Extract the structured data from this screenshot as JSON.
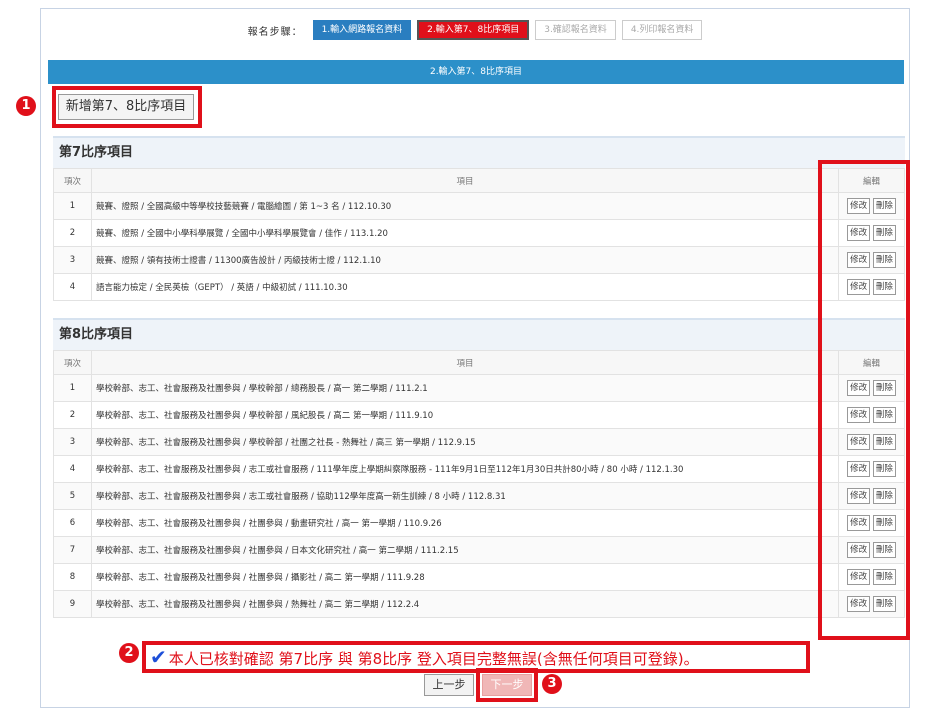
{
  "steps": {
    "label": "報名步驟：",
    "items": [
      {
        "label": "1.輸入網路報名資料",
        "state": "done"
      },
      {
        "label": "2.輸入第7、8比序項目",
        "state": "active"
      },
      {
        "label": "3.確認報名資料",
        "state": "pending"
      },
      {
        "label": "4.列印報名資料",
        "state": "pending"
      }
    ]
  },
  "banner": "2.輸入第7、8比序項目",
  "add_button": "新增第7、8比序項目",
  "badges": [
    "1",
    "2",
    "3"
  ],
  "section7": {
    "title": "第7比序項目",
    "headers": {
      "num": "項次",
      "item": "項目",
      "edit": "編輯"
    },
    "rows": [
      {
        "num": "1",
        "item": "競賽、證照 / 全國高級中等學校技藝競賽 / 電腦繪圖 / 第 1~3 名 / 112.10.30"
      },
      {
        "num": "2",
        "item": "競賽、證照 / 全國中小學科學展覽 / 全國中小學科學展覽會 / 佳作 / 113.1.20"
      },
      {
        "num": "3",
        "item": "競賽、證照 / 領有技術士證書 / 11300廣告設計 / 丙級技術士證 / 112.1.10"
      },
      {
        "num": "4",
        "item": "語言能力檢定 / 全民英檢（GEPT） / 英語 / 中級初試 / 111.10.30"
      }
    ]
  },
  "section8": {
    "title": "第8比序項目",
    "headers": {
      "num": "項次",
      "item": "項目",
      "edit": "編輯"
    },
    "rows": [
      {
        "num": "1",
        "item": "學校幹部、志工、社會服務及社團參與 / 學校幹部 / 總務股長 / 高一 第二學期 / 111.2.1"
      },
      {
        "num": "2",
        "item": "學校幹部、志工、社會服務及社團參與 / 學校幹部 / 風紀股長 / 高二 第一學期 / 111.9.10"
      },
      {
        "num": "3",
        "item": "學校幹部、志工、社會服務及社團參與 / 學校幹部 / 社團之社長 - 熱舞社 / 高三 第一學期 / 112.9.15"
      },
      {
        "num": "4",
        "item": "學校幹部、志工、社會服務及社團參與 / 志工或社會服務 / 111學年度上學期糾察隊服務 - 111年9月1日至112年1月30日共計80小時 / 80 小時 / 112.1.30"
      },
      {
        "num": "5",
        "item": "學校幹部、志工、社會服務及社團參與 / 志工或社會服務 / 協助112學年度高一新生訓練 / 8 小時 / 112.8.31"
      },
      {
        "num": "6",
        "item": "學校幹部、志工、社會服務及社團參與 / 社團參與 / 動畫研究社 / 高一 第一學期 / 110.9.26"
      },
      {
        "num": "7",
        "item": "學校幹部、志工、社會服務及社團參與 / 社團參與 / 日本文化研究社 / 高一 第二學期 / 111.2.15"
      },
      {
        "num": "8",
        "item": "學校幹部、志工、社會服務及社團參與 / 社團參與 / 攝影社 / 高二 第一學期 / 111.9.28"
      },
      {
        "num": "9",
        "item": "學校幹部、志工、社會服務及社團參與 / 社團參與 / 熱舞社 / 高二 第二學期 / 112.2.4"
      }
    ]
  },
  "row_actions": {
    "edit": "修改",
    "delete": "刪除"
  },
  "confirm": {
    "checked": true,
    "check_glyph": "✔",
    "text": "本人已核對確認 第7比序 與 第8比序 登入項目完整無誤(含無任何項目可登錄)。"
  },
  "nav": {
    "prev": "上一步",
    "next": "下一步"
  },
  "colors": {
    "highlight": "#e0101a",
    "banner": "#2c90c9",
    "step_done": "#2a7ec0",
    "check": "#1d4fd8"
  }
}
